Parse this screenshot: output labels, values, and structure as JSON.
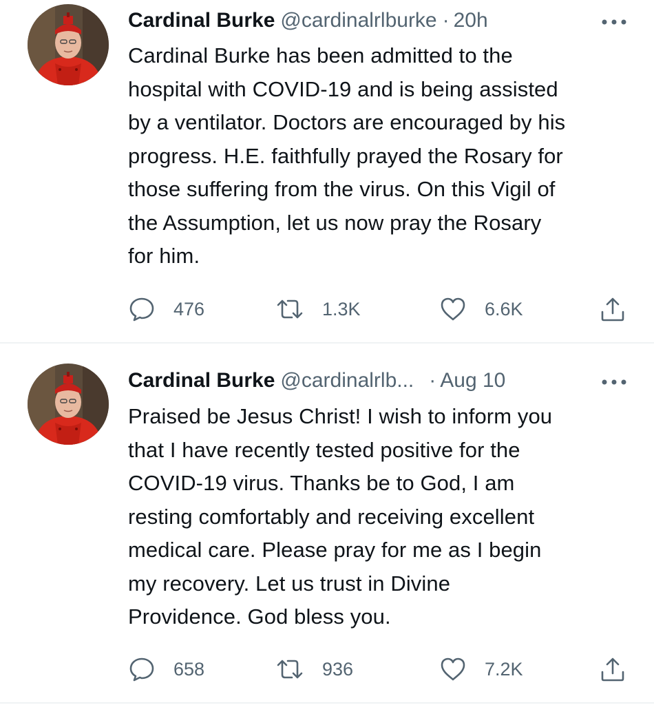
{
  "colors": {
    "text_primary": "#0f1419",
    "text_secondary": "#536471",
    "divider": "#eff3f4",
    "icon": "#536471"
  },
  "tweets": [
    {
      "name": "Cardinal Burke",
      "handle": "@cardinalrlburke",
      "separator": "·",
      "time": "20h",
      "more_icon": "more-horizontal-icon",
      "avatar_icon": "profile-photo",
      "body_lines": [
        "Cardinal Burke has been admitted to the",
        "hospital with COVID-19 and is being assisted",
        "by a ventilator. Doctors are encouraged by his",
        "progress. H.E. faithfully prayed the Rosary for",
        "those suffering from the virus. On this Vigil of",
        "the Assumption, let us now pray the Rosary",
        "for him."
      ],
      "replies": "476",
      "retweets": "1.3K",
      "likes": "6.6K"
    },
    {
      "name": "Cardinal Burke",
      "handle": "@cardinalrlb...",
      "separator": "·",
      "time": "Aug 10",
      "more_icon": "more-horizontal-icon",
      "avatar_icon": "profile-photo",
      "body_lines": [
        "Praised be Jesus Christ! I wish to inform you",
        "that I have recently tested positive for the",
        "COVID-19 virus. Thanks be to God, I am",
        "resting comfortably and receiving excellent",
        "medical care. Please pray for me as I begin",
        "my recovery. Let us trust in Divine",
        "Providence. God bless you."
      ],
      "replies": "658",
      "retweets": "936",
      "likes": "7.2K"
    }
  ]
}
